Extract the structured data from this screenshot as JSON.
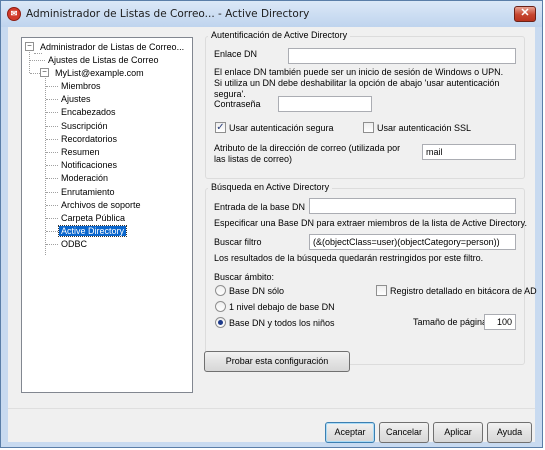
{
  "window": {
    "title": "Administrador de Listas de Correo... - Active Directory"
  },
  "tree": {
    "root": "Administrador de Listas de Correo...",
    "ajustes_listas": "Ajustes de Listas de Correo",
    "list": "MyList@example.com",
    "items": [
      "Miembros",
      "Ajustes",
      "Encabezados",
      "Suscripción",
      "Recordatorios",
      "Resumen",
      "Notificaciones",
      "Moderación",
      "Enrutamiento",
      "Archivos de soporte",
      "Carpeta Pública",
      "Active Directory",
      "ODBC"
    ],
    "selected": "Active Directory"
  },
  "auth": {
    "legend": "Autentificación de Active Directory",
    "dn_label": "Enlace DN",
    "dn_value": "",
    "help": "El enlace DN también puede ser un inicio de sesión de Windows o UPN.  Si utiliza un DN debe deshabilitar la opción de abajo 'usar autenticación segura'.",
    "password_label": "Contraseña",
    "password_value": "",
    "secure_label": "Usar autenticación segura",
    "secure_checked": true,
    "ssl_label": "Usar autenticación SSL",
    "ssl_checked": false,
    "mail_attr_label": "Atributo de la dirección de correo (utilizada por las listas de correo)",
    "mail_attr_value": "mail"
  },
  "search": {
    "legend": "Búsqueda en Active Directory",
    "base_label": "Entrada de la base DN",
    "base_value": "",
    "base_help": "Especificar una Base DN para extraer miembros de la lista de Active Directory.",
    "filter_label": "Buscar filtro",
    "filter_value": "(&(objectClass=user)(objectCategory=person))",
    "filter_help": "Los resultados de la búsqueda quedarán restringidos por este filtro.",
    "scope_label": "Buscar ámbito:",
    "scope_options": [
      "Base DN sólo",
      "1 nivel debajo de base DN",
      "Base DN y todos los niños"
    ],
    "scope_selected": "Base DN y todos los niños",
    "log_label": "Registro detallado en bitácora de AD",
    "log_checked": false,
    "page_size_label": "Tamaño de página",
    "page_size_value": "100"
  },
  "test_button": "Probar esta configuración",
  "buttons": {
    "ok": "Aceptar",
    "cancel": "Cancelar",
    "apply": "Aplicar",
    "help": "Ayuda"
  }
}
